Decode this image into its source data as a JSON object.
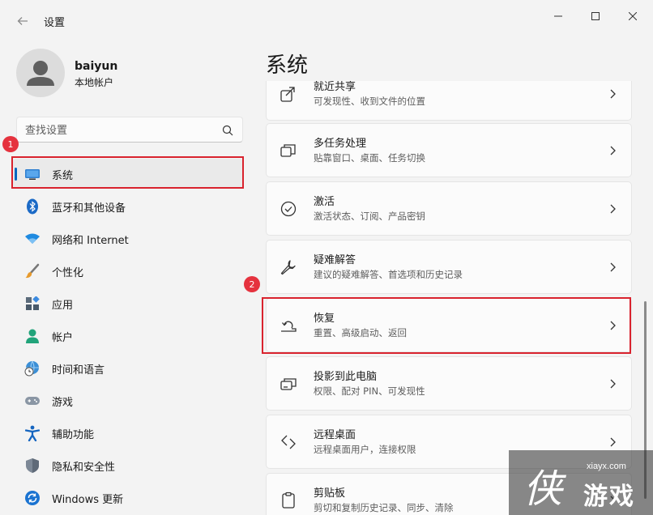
{
  "window": {
    "title": "设置"
  },
  "user": {
    "name": "baiyun",
    "account_type": "本地帐户"
  },
  "search": {
    "placeholder": "查找设置"
  },
  "sidebar": {
    "items": [
      {
        "label": "系统",
        "icon": "display-icon",
        "selected": true
      },
      {
        "label": "蓝牙和其他设备",
        "icon": "bluetooth-icon"
      },
      {
        "label": "网络和 Internet",
        "icon": "wifi-icon"
      },
      {
        "label": "个性化",
        "icon": "brush-icon"
      },
      {
        "label": "应用",
        "icon": "apps-icon"
      },
      {
        "label": "帐户",
        "icon": "person-icon"
      },
      {
        "label": "时间和语言",
        "icon": "globe-clock-icon"
      },
      {
        "label": "游戏",
        "icon": "gamepad-icon"
      },
      {
        "label": "辅助功能",
        "icon": "accessibility-icon"
      },
      {
        "label": "隐私和安全性",
        "icon": "shield-icon"
      },
      {
        "label": "Windows 更新",
        "icon": "update-icon"
      }
    ]
  },
  "main": {
    "title": "系统",
    "cards": [
      {
        "title": "就近共享",
        "subtitle": "可发现性、收到文件的位置",
        "icon": "share-icon"
      },
      {
        "title": "多任务处理",
        "subtitle": "贴靠窗口、桌面、任务切换",
        "icon": "multitask-icon"
      },
      {
        "title": "激活",
        "subtitle": "激活状态、订阅、产品密钥",
        "icon": "check-circle-icon"
      },
      {
        "title": "疑难解答",
        "subtitle": "建议的疑难解答、首选项和历史记录",
        "icon": "wrench-icon"
      },
      {
        "title": "恢复",
        "subtitle": "重置、高级启动、返回",
        "icon": "recovery-icon"
      },
      {
        "title": "投影到此电脑",
        "subtitle": "权限、配对 PIN、可发现性",
        "icon": "project-icon"
      },
      {
        "title": "远程桌面",
        "subtitle": "远程桌面用户，连接权限",
        "icon": "remote-desktop-icon"
      },
      {
        "title": "剪贴板",
        "subtitle": "剪切和复制历史记录、同步、清除",
        "icon": "clipboard-icon"
      }
    ]
  },
  "annotations": {
    "badge_1": "1",
    "badge_2": "2"
  },
  "watermark": {
    "url": "xiayx.com",
    "text": "游戏",
    "logo": "侠"
  },
  "colors": {
    "accent": "#0067c0",
    "annotation_red": "#d9232e"
  }
}
